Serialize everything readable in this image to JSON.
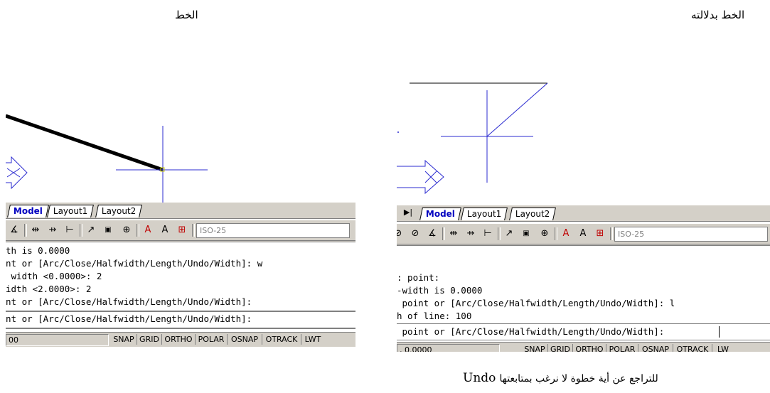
{
  "captions": {
    "left_title": "الخط",
    "right_title": "الخط بدلالته",
    "bottom_note_undo": "Undo",
    "bottom_note_text": "للتراجع عن أية خطوة لا نرغب بمتابعتها"
  },
  "colors": {
    "crosshair": "#2b2bd0",
    "toolbar_bg": "#d4d0c8",
    "active_tab": "#0000c0"
  },
  "left_panel": {
    "tabs": [
      "Model",
      "Layout1",
      "Layout2"
    ],
    "dimstyle": "ISO-25",
    "command_lines": [
      "th is 0.0000",
      "nt or [Arc/Close/Halfwidth/Length/Undo/Width]: w",
      " width <0.0000>: 2",
      "idth <2.0000>: 2",
      "nt or [Arc/Close/Halfwidth/Length/Undo/Width]:"
    ],
    "prompt": "nt or [Arc/Close/Halfwidth/Length/Undo/Width]:",
    "status_coords": "00",
    "status_buttons": [
      "SNAP",
      "GRID",
      "ORTHO",
      "POLAR",
      "OSNAP",
      "OTRACK",
      "LWT"
    ]
  },
  "right_panel": {
    "tabs": [
      "Model",
      "Layout1",
      "Layout2"
    ],
    "dimstyle": "ISO-25",
    "command_lines": [
      ": point:",
      "-width is 0.0000",
      " point or [Arc/Close/Halfwidth/Length/Undo/Width]: l",
      "h of line: 100"
    ],
    "prompt": " point or [Arc/Close/Halfwidth/Length/Undo/Width]: ",
    "status_coords": ", 0.0000",
    "status_buttons": [
      "SNAP",
      "GRID",
      "ORTHO",
      "POLAR",
      "OSNAP",
      "OTRACK",
      "LW"
    ]
  }
}
